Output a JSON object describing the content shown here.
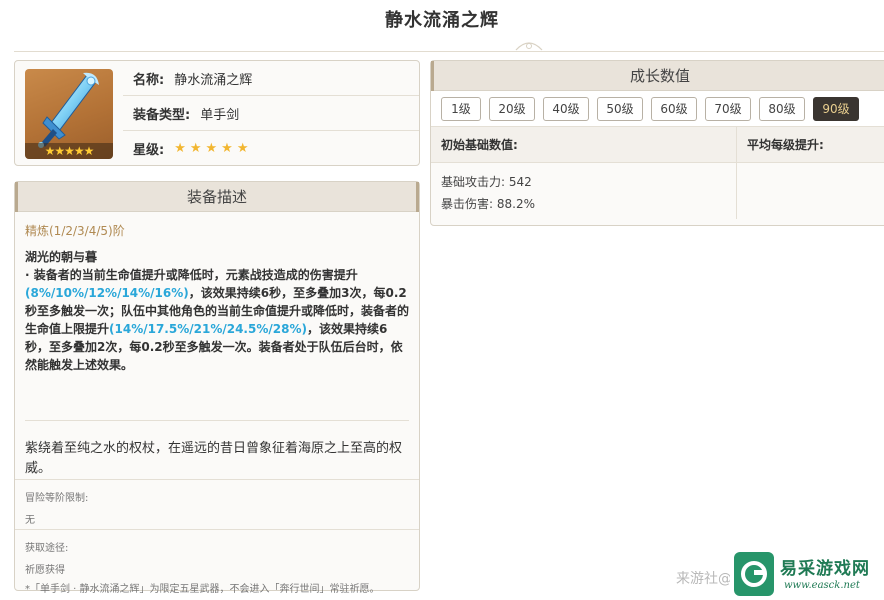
{
  "page": {
    "title": "静水流涌之辉"
  },
  "info": {
    "name_label": "名称:",
    "name_value": "静水流涌之辉",
    "type_label": "装备类型:",
    "type_value": "单手剑",
    "rarity_label": "星级:",
    "rarity_stars": "★★★★★",
    "rarity_count": 5,
    "image_stars": "★★★★★"
  },
  "description": {
    "header": "装备描述",
    "refine": "精炼(1/2/3/4/5)阶",
    "skill_title": "湖光的朝与暮",
    "skill_p1": "· 装备者的当前生命值提升或降低时，元素战技造成的伤害提升",
    "skill_hl1": "(8%/10%/12%/14%/16%)",
    "skill_p2": "，该效果持续6秒，至多叠加3次，每0.2秒至多触发一次；队伍中其他角色的当前生命值提升或降低时，装备者的生命值上限提升",
    "skill_hl2": "(14%/17.5%/21%/24.5%/28%)",
    "skill_p3": "，该效果持续6秒，至多叠加2次，每0.2秒至多触发一次。装备者处于队伍后台时，依然能触发上述效果。",
    "flavor": "紫绕着至纯之水的权杖，在遥远的昔日曾象征着海原之上至高的权威。",
    "limit_label": "冒险等阶限制:",
    "limit_value": "无",
    "source_label": "获取途径:",
    "source_value": "祈愿获得",
    "note": "*「单手剑 · 静水流涌之辉」为限定五星武器，不会进入「奔行世间」常驻祈愿。"
  },
  "growth": {
    "header": "成长数值",
    "levels": [
      "1级",
      "20级",
      "40级",
      "50级",
      "60级",
      "70级",
      "80级",
      "90级"
    ],
    "active_level": "90级",
    "col_base": "初始基础数值:",
    "col_avg": "平均每级提升:",
    "stat_atk": "基础攻击力: 542",
    "stat_crit": "暴击伤害: 88.2%"
  },
  "watermark": {
    "text": "来游社@",
    "logo_name": "易采游戏网",
    "logo_url": "www.easck.net"
  },
  "colors": {
    "accent_blue": "#2aa7d9",
    "refine_gold": "#b08a52",
    "star_gold": "#f2b630",
    "active_btn_bg": "#3a3530",
    "logo_green": "#27956a"
  }
}
